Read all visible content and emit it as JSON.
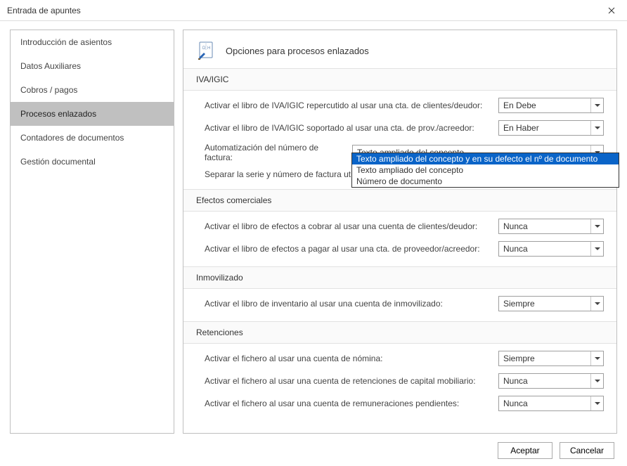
{
  "window": {
    "title": "Entrada de apuntes"
  },
  "sidebar": {
    "items": [
      "Introducción de asientos",
      "Datos Auxiliares",
      "Cobros / pagos",
      "Procesos enlazados",
      "Contadores de documentos",
      "Gestión documental"
    ],
    "active_index": 3
  },
  "main": {
    "title": "Opciones para procesos enlazados",
    "sections": {
      "iva": {
        "title": "IVA/IGIC",
        "rows": {
          "repercutido": {
            "label": "Activar el libro de IVA/IGIC repercutido al usar una cta. de clientes/deudor:",
            "value": "En Debe"
          },
          "soportado": {
            "label": "Activar el libro de IVA/IGIC soportado al usar una cta. de prov./acreedor:",
            "value": "En Haber"
          },
          "autonum": {
            "label": "Automatización del número de factura:",
            "value": "Texto ampliado del concepto",
            "options": [
              "Texto ampliado del concepto y en su defecto el nº de documento",
              "Texto ampliado del concepto",
              "Número de documento"
            ],
            "highlight_index": 0
          },
          "separar": {
            "label": "Separar la serie y número de factura utilizan"
          }
        }
      },
      "efectos": {
        "title": "Efectos comerciales",
        "rows": {
          "cobrar": {
            "label": "Activar el libro de efectos a cobrar al usar una cuenta de clientes/deudor:",
            "value": "Nunca"
          },
          "pagar": {
            "label": "Activar el libro de efectos a pagar al usar una cta. de proveedor/acreedor:",
            "value": "Nunca"
          }
        }
      },
      "inmov": {
        "title": "Inmovilizado",
        "rows": {
          "inv": {
            "label": "Activar el libro de inventario al usar una cuenta de inmovilizado:",
            "value": "Siempre"
          }
        }
      },
      "reten": {
        "title": "Retenciones",
        "rows": {
          "nomina": {
            "label": "Activar el fichero al usar una cuenta de nómina:",
            "value": "Siempre"
          },
          "capital": {
            "label": "Activar el fichero al usar una cuenta de retenciones de capital mobiliario:",
            "value": "Nunca"
          },
          "remun": {
            "label": "Activar el fichero al usar una cuenta de remuneraciones pendientes:",
            "value": "Nunca"
          }
        }
      }
    }
  },
  "footer": {
    "accept": "Aceptar",
    "cancel": "Cancelar"
  }
}
